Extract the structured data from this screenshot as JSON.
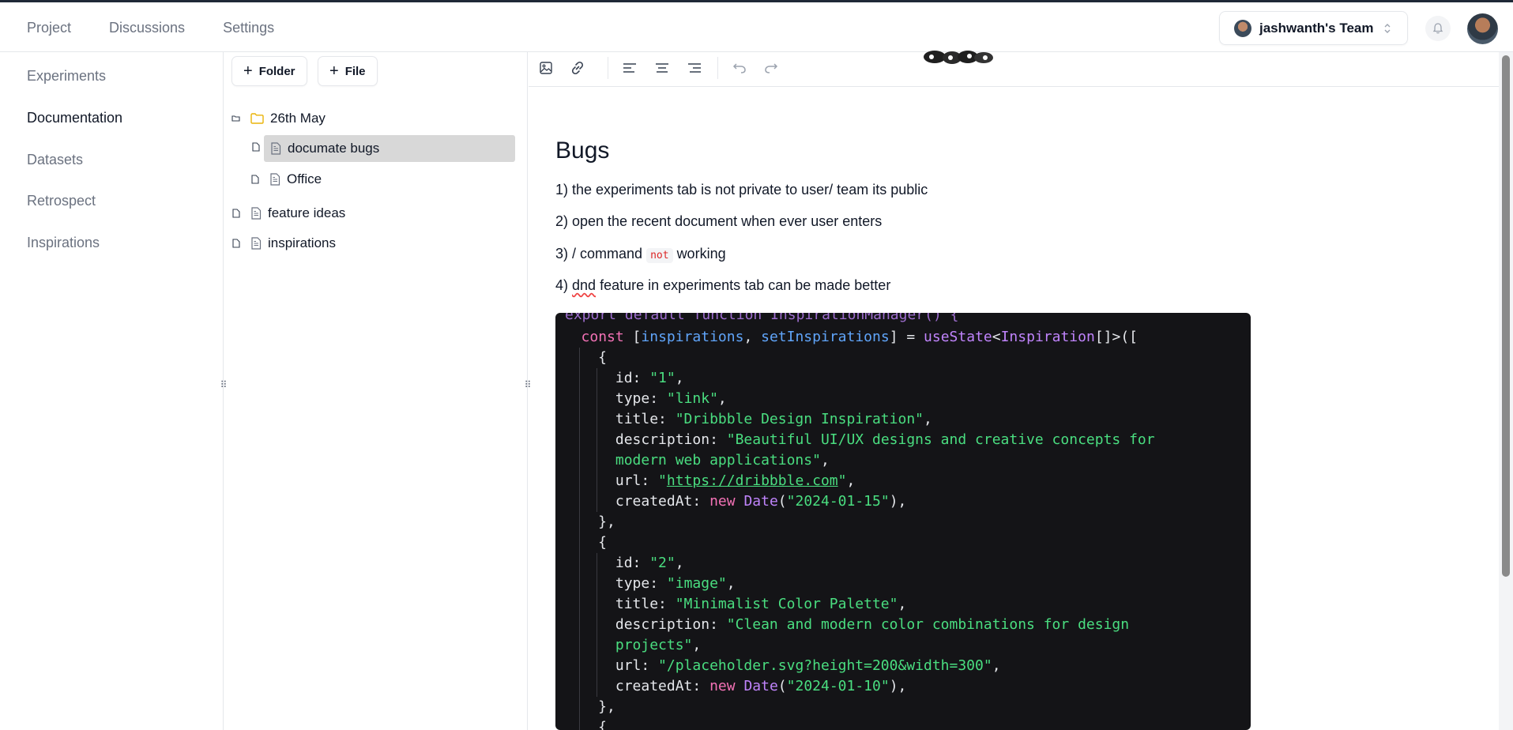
{
  "topnav": {
    "items": [
      "Project",
      "Discussions",
      "Settings"
    ]
  },
  "team": {
    "name": "jashwanth's Team",
    "chevron": "⌃⌄"
  },
  "icons": {
    "bell": "bell-icon",
    "avatar": "user-avatar"
  },
  "sidebar": {
    "items": [
      {
        "label": "Experiments",
        "active": false
      },
      {
        "label": "Documentation",
        "active": true
      },
      {
        "label": "Datasets",
        "active": false
      },
      {
        "label": "Retrospect",
        "active": false
      },
      {
        "label": "Inspirations",
        "active": false
      }
    ]
  },
  "tree": {
    "folder_button": "Folder",
    "file_button": "File",
    "items": [
      {
        "label": "26th May",
        "type": "folder",
        "expanded": true
      },
      {
        "label": "documate bugs",
        "type": "file",
        "selected": true
      },
      {
        "label": "Office",
        "type": "file"
      },
      {
        "label": "feature ideas",
        "type": "file"
      },
      {
        "label": "inspirations",
        "type": "file"
      }
    ]
  },
  "document": {
    "title": "Bugs",
    "lines": [
      {
        "prefix": "1) the experiments tab is not private to user/ team its public"
      },
      {
        "prefix": "2) open the recent document when ever user enters"
      },
      {
        "prefix": "3) / command",
        "code": "not",
        "suffix": "working"
      },
      {
        "prefix": "4)",
        "squiggle": "dnd",
        "suffix": "feature in experiments tab can be made better"
      }
    ],
    "code_header": "export default function InspirationManager() {",
    "code": {
      "const_kw": "const",
      "var1": "inspirations",
      "var2": "setInspirations",
      "hook": "useState",
      "type": "Inspiration",
      "items": [
        {
          "id": "\"1\"",
          "type": "\"link\"",
          "title": "\"Dribbble Design Inspiration\"",
          "description1": "\"Beautiful UI/UX designs and creative concepts for",
          "description2": "modern web applications\"",
          "url": "https://dribbble.com",
          "date": "\"2024-01-15\""
        },
        {
          "id": "\"2\"",
          "type": "\"image\"",
          "title": "\"Minimalist Color Palette\"",
          "description1": "\"Clean and modern color combinations for design",
          "description2": "projects\"",
          "url": "\"/placeholder.svg?height=200&width=300\"",
          "date": "\"2024-01-10\""
        }
      ],
      "new_kw": "new",
      "date_fn": "Date"
    }
  },
  "colors": {
    "code_bg": "#141417",
    "keyword": "#f472b6",
    "variable": "#60a5fa",
    "function": "#c084fc",
    "string": "#4ade80",
    "inline_code": "#dc2626",
    "selected_row": "#d8d8d8"
  }
}
